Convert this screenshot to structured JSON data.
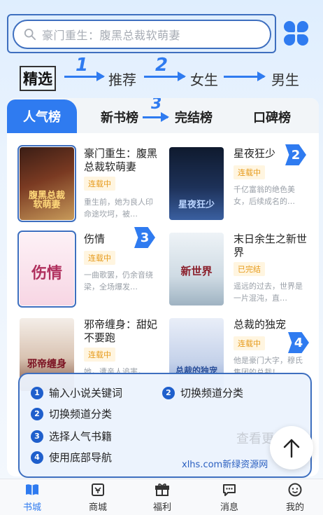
{
  "search": {
    "placeholder": "豪门重生：腹黑总裁软萌妻"
  },
  "channels": {
    "items": [
      "精选",
      "推荐",
      "女生",
      "男生"
    ],
    "steps": [
      "1",
      "2"
    ]
  },
  "tabs": {
    "items": [
      "人气榜",
      "新书榜",
      "完结榜",
      "口碑榜"
    ],
    "step": "3"
  },
  "books": [
    {
      "title": "豪门重生：腹黑总裁软萌妻",
      "status": "连载中",
      "desc": "重生前，她为良人印命途坎坷，被…",
      "cover_title": "腹黑总裁\n软萌妻"
    },
    {
      "title": "星夜狂少",
      "status": "连载中",
      "desc": "千亿富翁的绝色美女，后续成名的…",
      "cover_title": "星夜狂少"
    },
    {
      "title": "伤情",
      "status": "连载中",
      "desc": "一曲歌罢，仍余音绕梁，全场爆发…",
      "cover_title": "伤情"
    },
    {
      "title": "末日余生之新世界",
      "status": "已完结",
      "desc": "遥远的过去，世界是一片混沌，直…",
      "cover_title": "新世界"
    },
    {
      "title": "邪帝缠身：甜妃不要跑",
      "status": "连载中",
      "desc": "她，遭亲人追害，",
      "cover_title": "邪帝缠身"
    },
    {
      "title": "总裁的独宠",
      "status": "连载中",
      "desc": "他是豪门大字，穆氏集团的总裁！",
      "cover_title": "总裁的独宠"
    }
  ],
  "markers": [
    "2",
    "3",
    "4"
  ],
  "legend": {
    "items": [
      {
        "num": "1",
        "text": "输入小说关键词"
      },
      {
        "num": "2",
        "text": "切换频道分类"
      },
      {
        "num": "2",
        "text": "切换频道分类"
      },
      {
        "num": "3",
        "text": "选择人气书籍"
      },
      {
        "num": "4",
        "text": "使用底部导航"
      }
    ],
    "watermark": "xlhs.com新绿资源网",
    "more": "查看更"
  },
  "nav": {
    "items": [
      "书城",
      "商城",
      "福利",
      "消息",
      "我的"
    ]
  },
  "colors": {
    "accent": "#2f7bf0",
    "frame": "#3e6fbf",
    "badge": "#e69a1a"
  }
}
